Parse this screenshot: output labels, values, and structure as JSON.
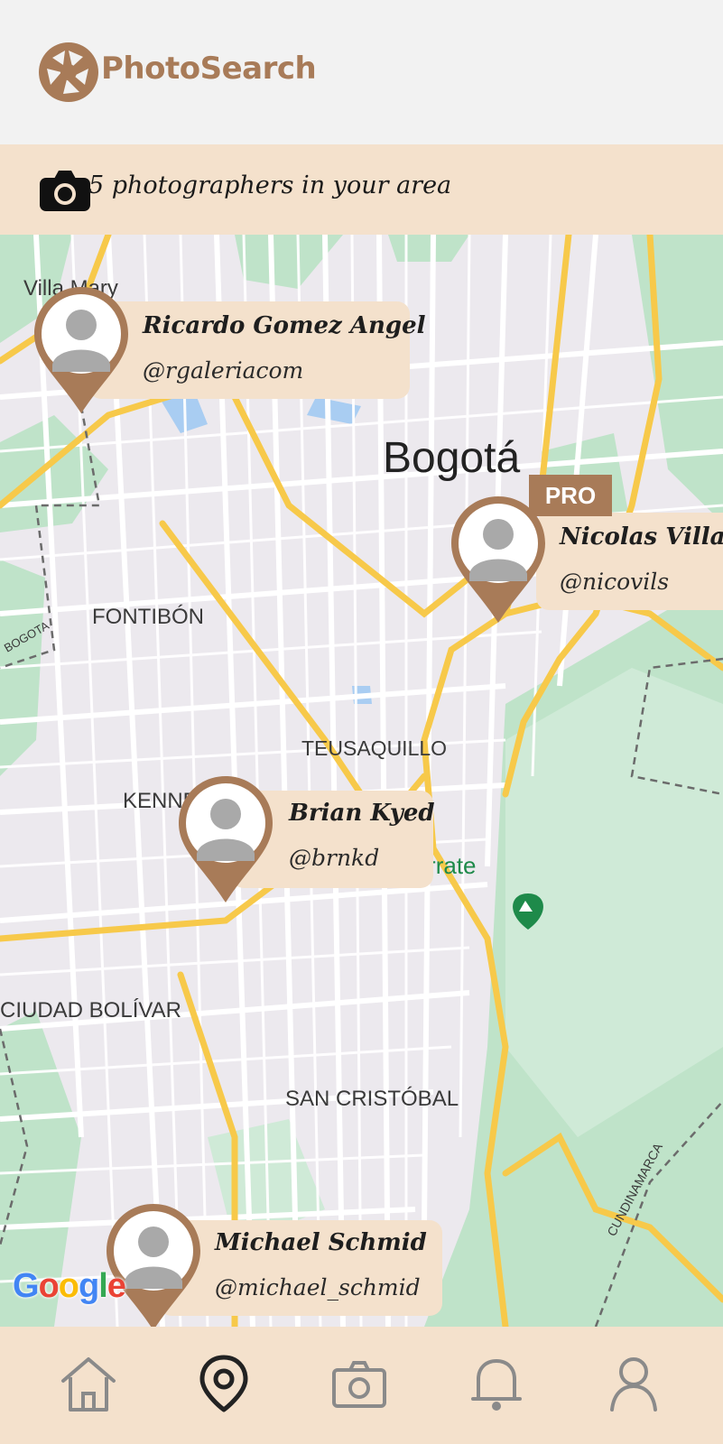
{
  "header": {
    "brand": "PhotoSearch",
    "logo_icon": "camera-aperture-icon"
  },
  "banner": {
    "icon": "camera-icon",
    "text": "5 photographers in your area"
  },
  "map": {
    "labels": {
      "villa": "Villa Mary",
      "city": "Bogotá",
      "fontibon": "FONTIBÓN",
      "bogota_river": "BOGOTA",
      "teusaquillo": "TEUSAQUILLO",
      "kennedy": "KENNEDY",
      "monserrate": "Monserrate",
      "ciudad_bolivar": "CIUDAD BOLÍVAR",
      "san_cristobal": "SAN CRISTÓBAL",
      "cundinamarca": "CUNDINAMARCA"
    },
    "attribution": "Google"
  },
  "photographers": [
    {
      "name": "Ricardo Gomez Angel",
      "handle": "@rgaleriacom",
      "pro": false
    },
    {
      "name": "Nicolas Villasi",
      "handle": "@nicovils",
      "pro": true,
      "badge": "PRO"
    },
    {
      "name": "Brian Kyed",
      "handle": "@brnkd",
      "pro": false
    },
    {
      "name": "Michael Schmid",
      "handle": "@michael_schmid",
      "pro": false
    }
  ],
  "nav": {
    "items": [
      "home-icon",
      "map-pin-icon",
      "camera-icon",
      "bell-icon",
      "user-icon"
    ],
    "active": "map-pin-icon"
  },
  "colors": {
    "brand": "#a87b58",
    "banner": "#f4e1cc",
    "park": "#bfe3c9",
    "road": "#f7c94a"
  }
}
